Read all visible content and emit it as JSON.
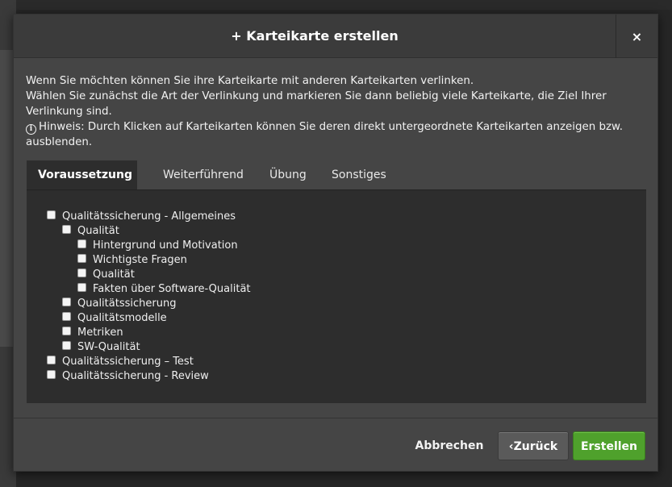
{
  "modal": {
    "title_plus": "+",
    "title": "Karteikarte erstellen",
    "close_label": "×",
    "intro_line1": "Wenn Sie möchten können Sie ihre Karteikarte mit anderen Karteikarten verlinken.",
    "intro_line2": "Wählen Sie zunächst die Art der Verlinkung und markieren Sie dann beliebig viele Karteikarte, die Ziel Ihrer Verlinkung sind.",
    "hint_icon": "info-icon",
    "hint_text": "Hinweis: Durch Klicken auf Karteikarten können Sie deren direkt untergeordnete Karteikarten anzeigen bzw. ausblenden."
  },
  "tabs": [
    {
      "label": "Voraussetzung",
      "active": true
    },
    {
      "label": "Weiterführend",
      "active": false
    },
    {
      "label": "Übung",
      "active": false
    },
    {
      "label": "Sonstiges",
      "active": false
    }
  ],
  "tree": [
    {
      "label": "Qualitätssicherung - Allgemeines",
      "level": 0,
      "checked": false
    },
    {
      "label": "Qualität",
      "level": 1,
      "checked": false
    },
    {
      "label": "Hintergrund und Motivation",
      "level": 2,
      "checked": false
    },
    {
      "label": "Wichtigste Fragen",
      "level": 2,
      "checked": false
    },
    {
      "label": "Qualität",
      "level": 2,
      "checked": false
    },
    {
      "label": "Fakten über Software-Qualität",
      "level": 2,
      "checked": false
    },
    {
      "label": "Qualitätssicherung",
      "level": 1,
      "checked": false
    },
    {
      "label": "Qualitätsmodelle",
      "level": 1,
      "checked": false
    },
    {
      "label": "Metriken",
      "level": 1,
      "checked": false
    },
    {
      "label": "SW-Qualität",
      "level": 1,
      "checked": false
    },
    {
      "label": "Qualitätssicherung – Test",
      "level": 0,
      "checked": false
    },
    {
      "label": "Qualitätssicherung - Review",
      "level": 0,
      "checked": false
    }
  ],
  "footer": {
    "cancel_label": "Abbrechen",
    "back_icon": "chevron-left-icon",
    "back_label": "Zurück",
    "create_label": "Erstellen"
  },
  "colors": {
    "modal_bg": "#454545",
    "panel_bg": "#2d2d2d",
    "create_button": "#4fa12c",
    "back_button": "#5a5a5a"
  }
}
